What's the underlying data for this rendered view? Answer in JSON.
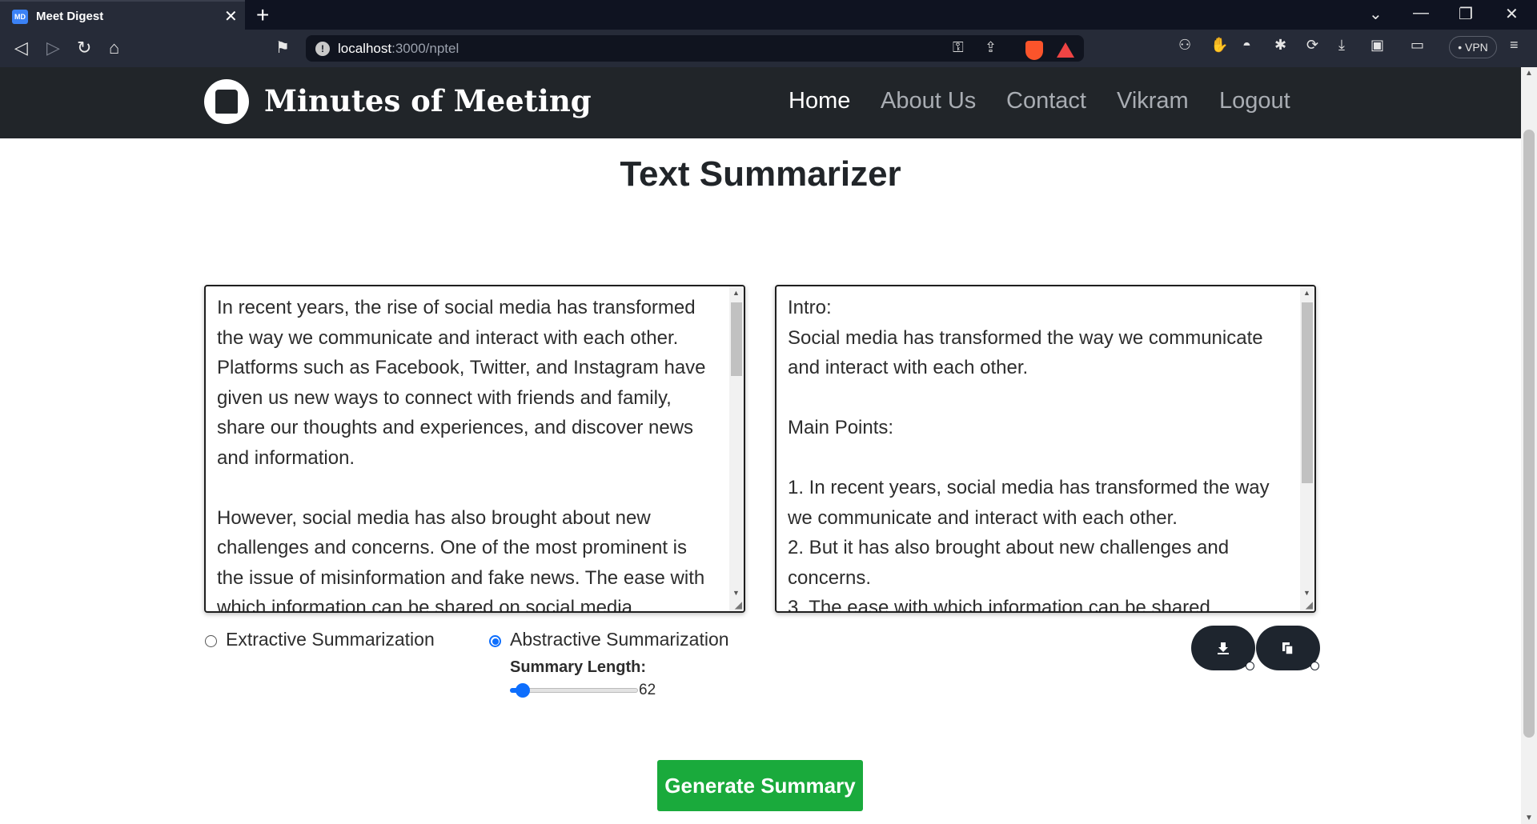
{
  "browser": {
    "tab_title": "Meet Digest",
    "favicon_text": "MD",
    "url_host": "localhost",
    "url_path": ":3000/nptel",
    "vpn_label": "• VPN"
  },
  "site": {
    "brand": "Minutes of Meeting",
    "nav": [
      "Home",
      "About Us",
      "Contact",
      "Vikram",
      "Logout"
    ],
    "active_nav": "Home"
  },
  "main": {
    "title": "Text Summarizer",
    "input_text": "In recent years, the rise of social media has transformed the way we communicate and interact with each other. Platforms such as Facebook, Twitter, and Instagram have given us new ways to connect with friends and family, share our thoughts and experiences, and discover news and information.\n\nHowever, social media has also brought about new challenges and concerns. One of the most prominent is the issue of misinformation and fake news. The ease with which information can be shared on social media",
    "output_text": "Intro:\nSocial media has transformed the way we communicate and interact with each other.\n\nMain Points:\n\n1. In recent years, social media has transformed the way we communicate and interact with each other.\n2. But it has also brought about new challenges and concerns.\n3. The ease with which information can be shared",
    "options": {
      "extractive_label": "Extractive Summarization",
      "abstractive_label": "Abstractive Summarization",
      "selected": "Abstractive Summarization"
    },
    "summary_length": {
      "label": "Summary Length:",
      "value": "62",
      "fraction": 0.1
    },
    "generate_label": "Generate Summary"
  },
  "icons": {
    "download_button": "download-icon",
    "copy_button": "copy-icon"
  },
  "colors": {
    "navbar": "#212529",
    "accent_blue": "#0d6efd",
    "generate_green": "#1aaa3c"
  }
}
